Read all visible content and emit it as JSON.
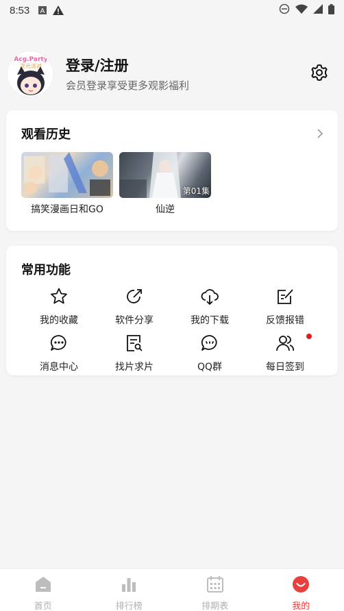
{
  "status_bar": {
    "time": "8:53"
  },
  "header": {
    "title": "登录/注册",
    "subtitle": "会员登录享受更多观影福利",
    "avatar_text": "Acg.Party 次元派对"
  },
  "history": {
    "title": "观看历史",
    "items": [
      {
        "caption": "搞笑漫画日和GO",
        "badge": ""
      },
      {
        "caption": "仙逆",
        "badge": "第01集"
      }
    ]
  },
  "tools": {
    "title": "常用功能",
    "items": [
      {
        "label": "我的收藏",
        "icon": "star-icon"
      },
      {
        "label": "软件分享",
        "icon": "share-icon"
      },
      {
        "label": "我的下载",
        "icon": "cloud-download-icon"
      },
      {
        "label": "反馈报错",
        "icon": "feedback-edit-icon"
      },
      {
        "label": "消息中心",
        "icon": "chat-bubble-icon"
      },
      {
        "label": "找片求片",
        "icon": "search-doc-icon"
      },
      {
        "label": "QQ群",
        "icon": "group-chat-icon"
      },
      {
        "label": "每日签到",
        "icon": "users-icon",
        "has_notification": true
      }
    ]
  },
  "bottom_nav": {
    "items": [
      {
        "label": "首页",
        "icon": "home-icon"
      },
      {
        "label": "排行榜",
        "icon": "ranking-icon"
      },
      {
        "label": "排期表",
        "icon": "calendar-icon"
      },
      {
        "label": "我的",
        "icon": "profile-smile-icon",
        "active": true
      }
    ]
  },
  "colors": {
    "accent": "#e8403f",
    "inactive": "#b0b0b0",
    "background": "#f5f5f5"
  }
}
